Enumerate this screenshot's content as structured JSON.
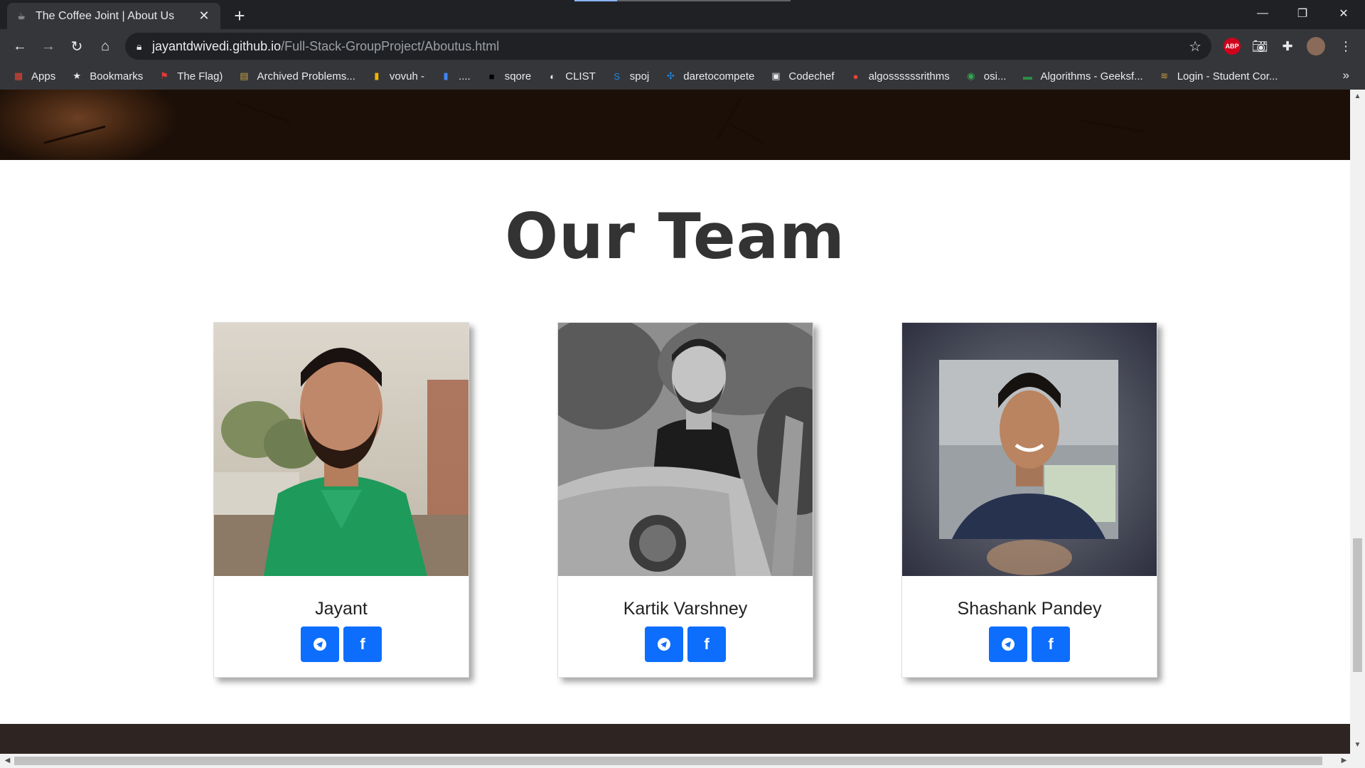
{
  "browser": {
    "tab_title": "The Coffee Joint | About Us",
    "new_tab_label": "+",
    "url_host": "jayantdwivedi.github.io",
    "url_path": "/Full-Stack-GroupProject/Aboutus.html",
    "bookmarks": [
      {
        "label": "Apps",
        "icon": "apps-grid-icon",
        "color": "#ea4335"
      },
      {
        "label": "Bookmarks",
        "icon": "star-icon",
        "color": "#e8eaed"
      },
      {
        "label": "The Flag)",
        "icon": "flag-icon",
        "color": "#e53935"
      },
      {
        "label": "Archived Problems...",
        "icon": "document-icon",
        "color": "#c8a040"
      },
      {
        "label": "vovuh -",
        "icon": "bar-chart-icon",
        "color": "#f4b400"
      },
      {
        "label": "....",
        "icon": "bar-chart-icon",
        "color": "#4285f4"
      },
      {
        "label": "sqore",
        "icon": "square-icon",
        "color": "#000000"
      },
      {
        "label": "CLIST",
        "icon": "globe-icon",
        "color": "#e8eaed"
      },
      {
        "label": "spoj",
        "icon": "spoj-icon",
        "color": "#1e88e5"
      },
      {
        "label": "daretocompete",
        "icon": "puzzle-icon",
        "color": "#1e88e5"
      },
      {
        "label": "Codechef",
        "icon": "codechef-icon",
        "color": "#e8eaed"
      },
      {
        "label": "algossssssrithms",
        "icon": "search-icon",
        "color": "#ea4335"
      },
      {
        "label": "osi...",
        "icon": "osi-icon",
        "color": "#34a853"
      },
      {
        "label": "Algorithms - Geeksf...",
        "icon": "gfg-icon",
        "color": "#2f8d46"
      },
      {
        "label": "Login - Student Cor...",
        "icon": "login-icon",
        "color": "#c8a040"
      }
    ],
    "bookmarks_more": "»",
    "abp_label": "ABP"
  },
  "page": {
    "title": "Our Team",
    "team": [
      {
        "name": "Jayant"
      },
      {
        "name": "Kartik Varshney"
      },
      {
        "name": "Shashank Pandey"
      }
    ]
  },
  "colors": {
    "social_button": "#0d6efd",
    "footer": "#2e2523",
    "chrome_dark": "#202124",
    "chrome_toolbar": "#35363a"
  }
}
